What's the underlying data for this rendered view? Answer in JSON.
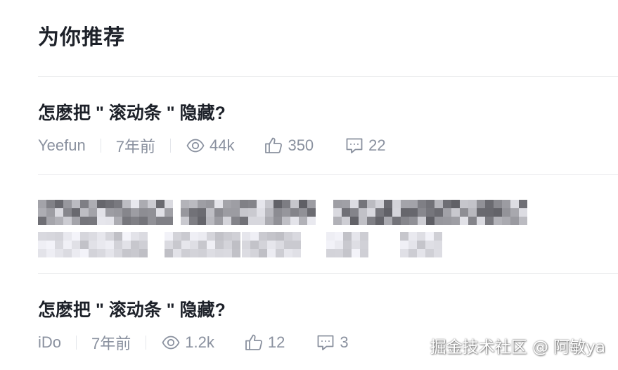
{
  "section": {
    "title": "为你推荐"
  },
  "articles": [
    {
      "title": "怎麽把 \" 滚动条 \" 隐藏?",
      "author": "Yeefun",
      "time": "7年前",
      "views": "44k",
      "likes": "350",
      "comments": "22"
    },
    {
      "title": "怎麽把 \" 滚动条 \" 隐藏?",
      "author": "iDo",
      "time": "7年前",
      "views": "1.2k",
      "likes": "12",
      "comments": "3"
    }
  ],
  "watermark": "掘金技术社区 @ 阿敏ya",
  "icons": {
    "views": "eye-icon",
    "likes": "thumbs-up-icon",
    "comments": "comment-icon"
  },
  "colors": {
    "title": "#1d2129",
    "meta": "#8a919f",
    "divider": "#e8e9eb"
  }
}
